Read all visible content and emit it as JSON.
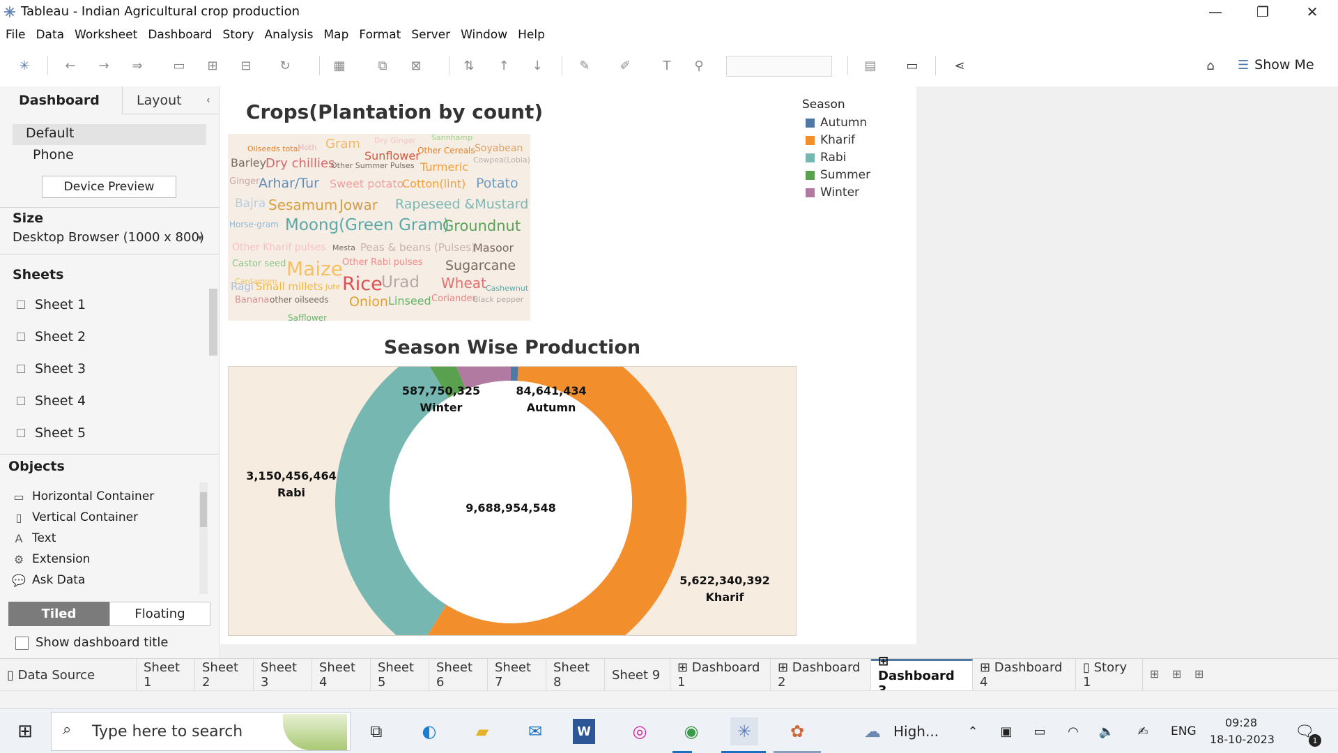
{
  "window": {
    "title": "Tableau - Indian Agricultural crop production"
  },
  "menu": [
    "File",
    "Data",
    "Worksheet",
    "Dashboard",
    "Story",
    "Analysis",
    "Map",
    "Format",
    "Server",
    "Window",
    "Help"
  ],
  "toolbar": {
    "show_me": "Show Me"
  },
  "left_pane": {
    "tabs": [
      "Dashboard",
      "Layout"
    ],
    "device_options": [
      "Default",
      "Phone"
    ],
    "device_preview": "Device Preview",
    "size_label": "Size",
    "size_value": "Desktop Browser (1000 x 800)",
    "sheets_label": "Sheets",
    "sheets": [
      "Sheet 1",
      "Sheet 2",
      "Sheet 3",
      "Sheet 4",
      "Sheet 5"
    ],
    "objects_label": "Objects",
    "objects": [
      {
        "label": "Horizontal Container",
        "icon": "horizontal-container-icon"
      },
      {
        "label": "Vertical Container",
        "icon": "vertical-container-icon"
      },
      {
        "label": "Text",
        "icon": "text-icon"
      },
      {
        "label": "Extension",
        "icon": "extension-icon"
      },
      {
        "label": "Ask Data",
        "icon": "ask-data-icon"
      }
    ],
    "layout_modes": [
      "Tiled",
      "Floating"
    ],
    "show_title": "Show dashboard title"
  },
  "dashboard": {
    "wordcloud_title": "Crops(Plantation by count)",
    "words": [
      {
        "t": "Oilseeds total",
        "s": 11,
        "c": "#e0802a"
      },
      {
        "t": "Moth",
        "s": 11,
        "c": "#e6b6b6"
      },
      {
        "t": "Gram",
        "s": 18,
        "c": "#f1b866"
      },
      {
        "t": "Dry Ginger",
        "s": 11,
        "c": "#f5c4c4"
      },
      {
        "t": "Sannhamp",
        "s": 11,
        "c": "#9dd18c"
      },
      {
        "t": "Barley",
        "s": 16,
        "c": "#7a6a60"
      },
      {
        "t": "Dry chillies",
        "s": 18,
        "c": "#d16a6a"
      },
      {
        "t": "Other Summer Pulses",
        "s": 11,
        "c": "#7a6a60"
      },
      {
        "t": "Sunflower",
        "s": 16,
        "c": "#d0573a"
      },
      {
        "t": "Other Cereals",
        "s": 12,
        "c": "#e0802a"
      },
      {
        "t": "Soyabean",
        "s": 14,
        "c": "#e0a060"
      },
      {
        "t": "Turmeric",
        "s": 16,
        "c": "#f0a040"
      },
      {
        "t": "Cowpea(Lobia)",
        "s": 11,
        "c": "#b8b0b0"
      },
      {
        "t": "Ginger",
        "s": 13,
        "c": "#c9a8a8"
      },
      {
        "t": "Arhar/Tur",
        "s": 19,
        "c": "#5f8db8"
      },
      {
        "t": "Sweet potato",
        "s": 16,
        "c": "#f2a0a0"
      },
      {
        "t": "Cotton(lint)",
        "s": 16,
        "c": "#f0a040"
      },
      {
        "t": "Potato",
        "s": 19,
        "c": "#6a9ac2"
      },
      {
        "t": "Bajra",
        "s": 17,
        "c": "#b8cce0"
      },
      {
        "t": "Sesamum",
        "s": 20,
        "c": "#d8a040"
      },
      {
        "t": "Jowar",
        "s": 20,
        "c": "#d0a050"
      },
      {
        "t": "Rapeseed &Mustard",
        "s": 19,
        "c": "#7cb8b4"
      },
      {
        "t": "Horse-gram",
        "s": 12,
        "c": "#90b8d8"
      },
      {
        "t": "Moong(Green Gram)",
        "s": 23,
        "c": "#5aa8a8"
      },
      {
        "t": "Groundnut",
        "s": 21,
        "c": "#5aa25a"
      },
      {
        "t": "Other Kharif pulses",
        "s": 14,
        "c": "#f8c0c0"
      },
      {
        "t": "Mesta",
        "s": 11,
        "c": "#7a6a60"
      },
      {
        "t": "Peas & beans (Pulses)",
        "s": 15,
        "c": "#c8b0b0"
      },
      {
        "t": "Masoor",
        "s": 16,
        "c": "#7a6a60"
      },
      {
        "t": "Castor seed",
        "s": 13,
        "c": "#8bc38b"
      },
      {
        "t": "Maize",
        "s": 28,
        "c": "#f5c060"
      },
      {
        "t": "Other Rabi pulses",
        "s": 13,
        "c": "#f08a8a"
      },
      {
        "t": "Sugarcane",
        "s": 19,
        "c": "#7a6a60"
      },
      {
        "t": "Cardamom",
        "s": 11,
        "c": "#f0c060"
      },
      {
        "t": "Rice",
        "s": 27,
        "c": "#d85050"
      },
      {
        "t": "Urad",
        "s": 23,
        "c": "#b8a8a8"
      },
      {
        "t": "Wheat",
        "s": 20,
        "c": "#e07070"
      },
      {
        "t": "Ragi",
        "s": 15,
        "c": "#a8c0d8"
      },
      {
        "t": "Small millets",
        "s": 15,
        "c": "#f0b840"
      },
      {
        "t": "Jute",
        "s": 11,
        "c": "#f0b840"
      },
      {
        "t": "Cashewnut",
        "s": 11,
        "c": "#5aa8a8"
      },
      {
        "t": "Banana",
        "s": 13,
        "c": "#d89090"
      },
      {
        "t": "other oilseeds",
        "s": 12,
        "c": "#7a6a60"
      },
      {
        "t": "Onion",
        "s": 19,
        "c": "#e0a030"
      },
      {
        "t": "Linseed",
        "s": 16,
        "c": "#6ab46a"
      },
      {
        "t": "Coriander",
        "s": 13,
        "c": "#f08080"
      },
      {
        "t": "Black pepper",
        "s": 11,
        "c": "#b0a8a8"
      },
      {
        "t": "Safflower",
        "s": 12,
        "c": "#6ab46a"
      }
    ],
    "legend_title": "Season",
    "donut_title": "Season Wise Production",
    "total_label": "9,688,954,548"
  },
  "chart_data": {
    "type": "pie",
    "title": "Season Wise Production",
    "legend_title": "Season",
    "categories": [
      "Autumn",
      "Kharif",
      "Rabi",
      "Summer",
      "Winter"
    ],
    "values": [
      84641434,
      5622340392,
      3150456464,
      243516933,
      587750325
    ],
    "value_labels": [
      "84,641,434",
      "5,622,340,392",
      "3,150,456,464",
      "",
      "587,750,325"
    ],
    "colors": [
      "#4e79a7",
      "#f28e2b",
      "#76b7b2",
      "#59a14f",
      "#b07aa1"
    ],
    "total": "9,688,954,548",
    "donut": true
  },
  "bottom_tabs": [
    "Data Source",
    "Sheet 1",
    "Sheet 2",
    "Sheet 3",
    "Sheet 4",
    "Sheet 5",
    "Sheet 6",
    "Sheet 7",
    "Sheet 8",
    "Sheet 9",
    "Dashboard 1",
    "Dashboard 2",
    "Dashboard 3",
    "Dashboard 4",
    "Story 1"
  ],
  "active_tab": "Dashboard 3",
  "taskbar": {
    "search_placeholder": "Type here to search",
    "weather": "High...",
    "lang": "ENG",
    "time": "09:28",
    "date": "18-10-2023",
    "notif_count": "1"
  }
}
